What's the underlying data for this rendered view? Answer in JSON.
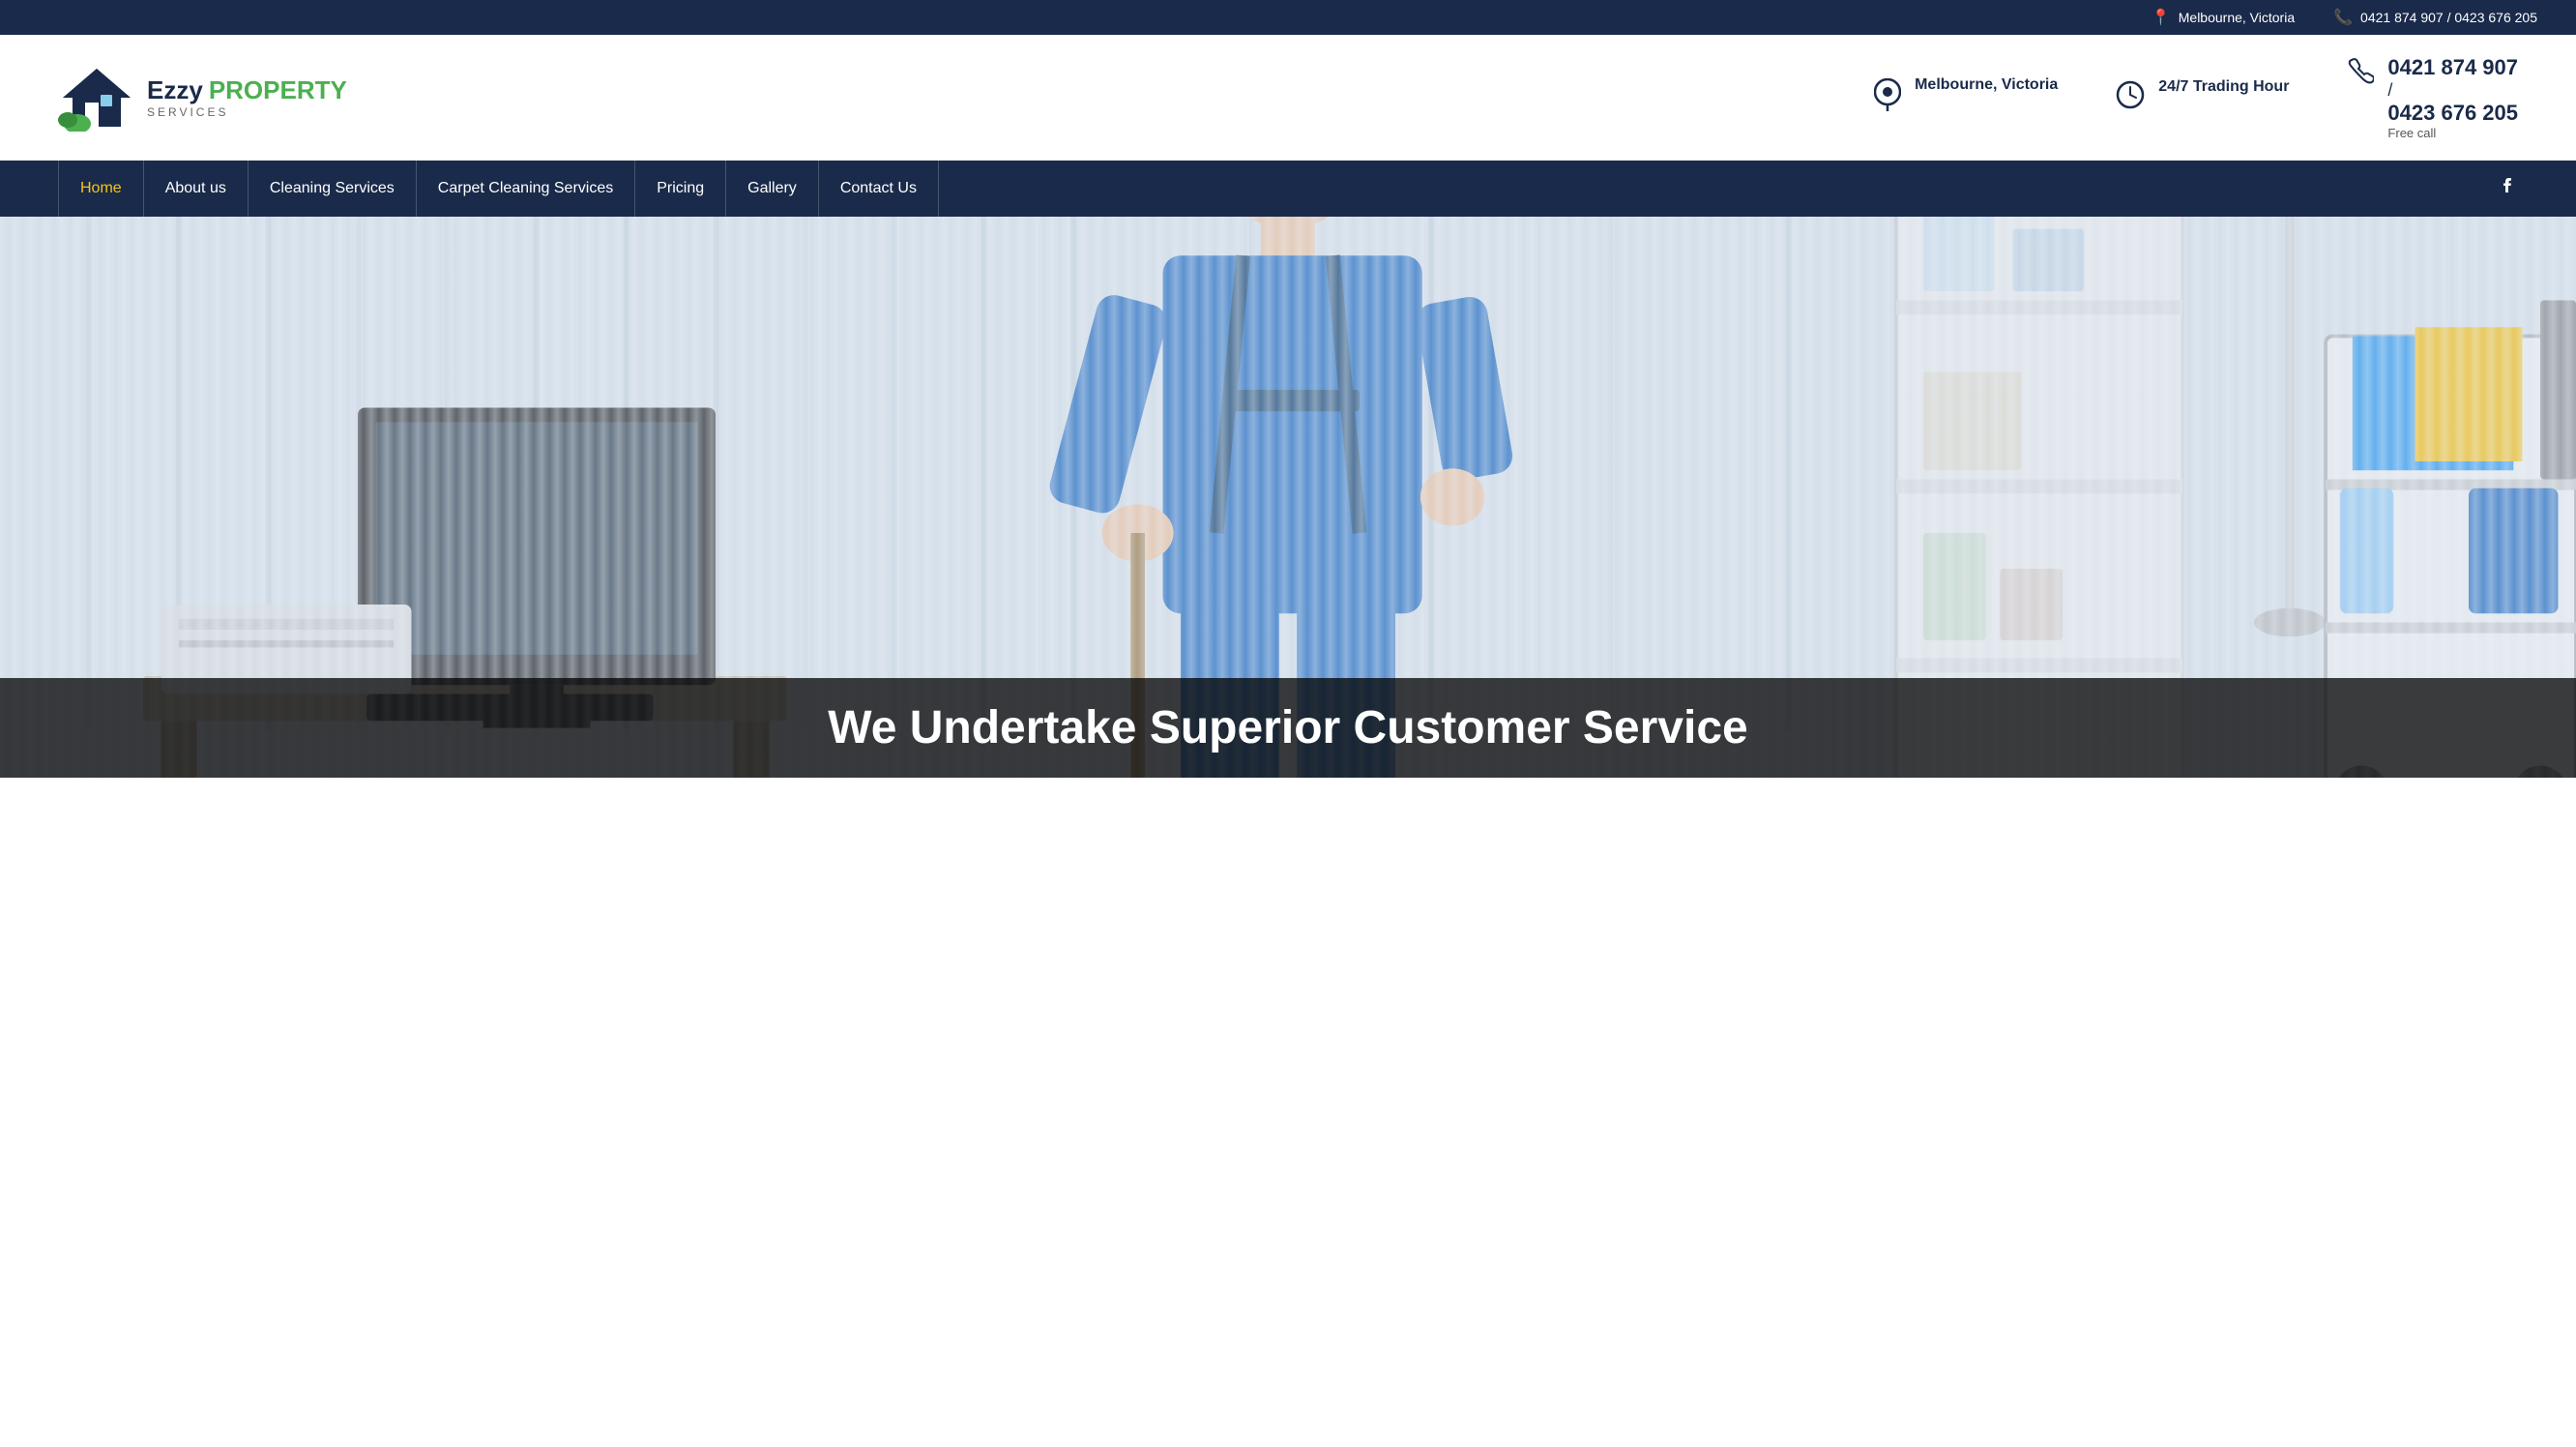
{
  "topbar": {
    "location": "Melbourne, Victoria",
    "phone": "0421 874 907 / 0423 676 205"
  },
  "header": {
    "logo": {
      "ezzy": "Ezzy",
      "property": "PROPERTY",
      "services": "SERVICES"
    },
    "info": {
      "location_label": "Melbourne, Victoria",
      "trading_label": "24/7 Trading Hour",
      "phone1": "0421 874 907",
      "slash": "/",
      "phone2": "0423 676 205",
      "free_call": "Free call"
    }
  },
  "nav": {
    "items": [
      {
        "label": "Home",
        "active": true
      },
      {
        "label": "About us",
        "active": false
      },
      {
        "label": "Cleaning Services",
        "active": false
      },
      {
        "label": "Carpet Cleaning Services",
        "active": false
      },
      {
        "label": "Pricing",
        "active": false
      },
      {
        "label": "Gallery",
        "active": false
      },
      {
        "label": "Contact Us",
        "active": false
      }
    ],
    "facebook_icon": "f"
  },
  "hero": {
    "headline": "We Undertake Superior Customer Service"
  }
}
